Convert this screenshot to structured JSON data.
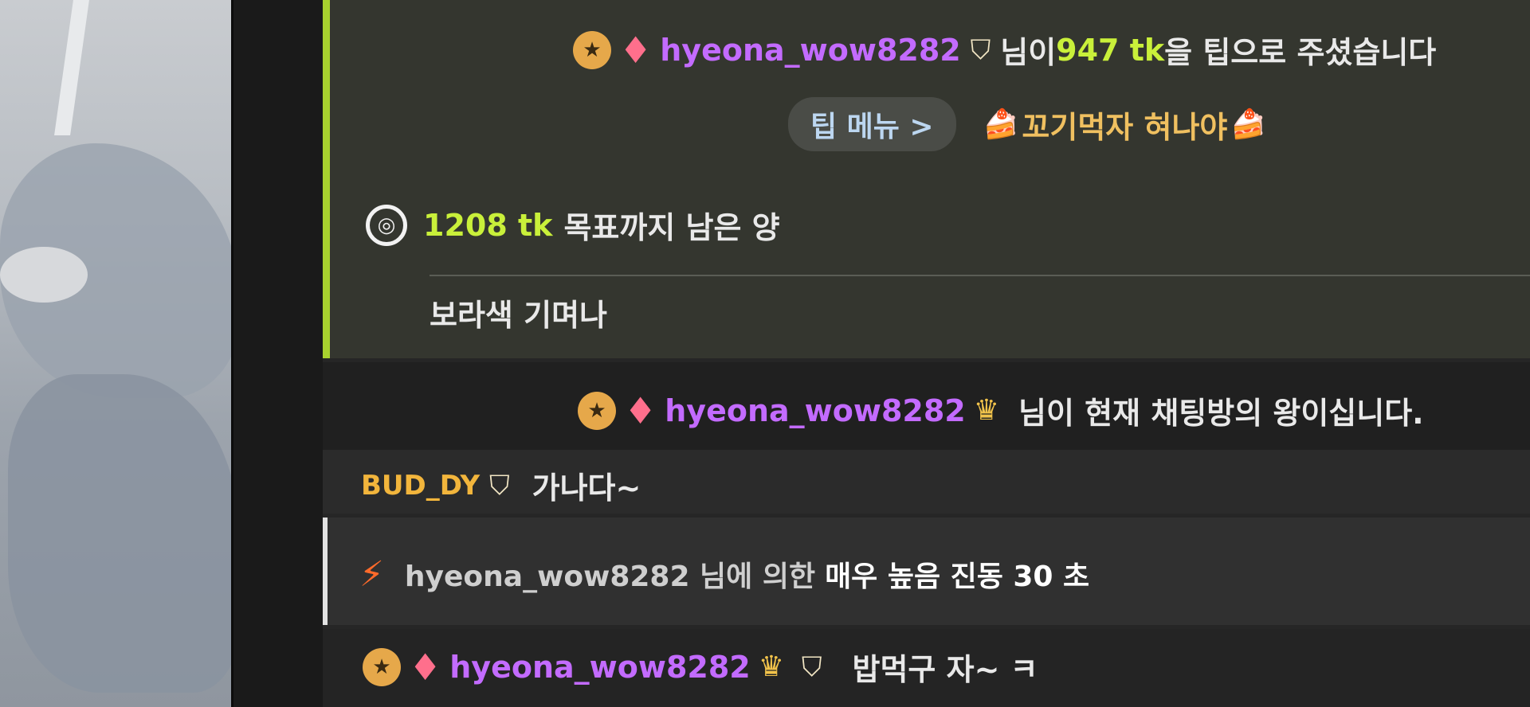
{
  "tip_event": {
    "username": "hyeona_wow8282",
    "text_before_amount": "님이 ",
    "amount": "947 tk",
    "text_after_amount": "을 팁으로 주셨습니다",
    "tip_menu_label": "팁 메뉴 >",
    "tip_menu_item": "꼬기먹자 혀나야",
    "goal_amount": "1208 tk",
    "goal_text": "목표까지 남은 양",
    "message": "보라색 기며나"
  },
  "king_event": {
    "username": "hyeona_wow8282",
    "text": "님이 현재 채팅방의 왕이십니다."
  },
  "chat_message": {
    "username": "BUD_DY",
    "text": "가나다~"
  },
  "vibration_event": {
    "text_prefix": "hyeona_wow8282 님에 의한",
    "text_strong": "매우 높음 진동 30 초"
  },
  "last_message": {
    "username": "hyeona_wow8282",
    "text": "밥먹구 자~ ㅋ"
  },
  "icons": {
    "star_badge": "star-badge-icon",
    "gem": "gem-icon",
    "shield": "shield-icon",
    "crown": "crown-icon",
    "goal": "goal-icon",
    "bolt": "bolt-icon",
    "cake": "cake-icon"
  },
  "colors": {
    "accent_green": "#c9f03a",
    "username_purple": "#c36bff",
    "buddy_gold": "#f2b53c",
    "bolt_orange": "#ff6a2a"
  }
}
